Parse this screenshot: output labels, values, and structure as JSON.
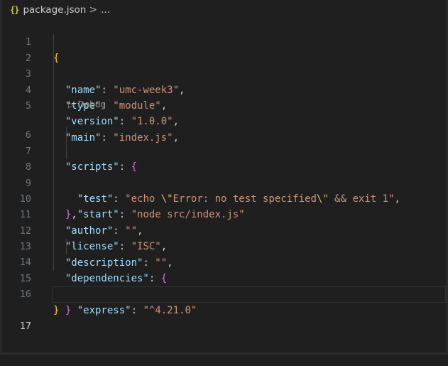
{
  "breadcrumb": {
    "icon": "{}",
    "file": "package.json",
    "separator": ">",
    "more": "..."
  },
  "codelens": {
    "label": "Debug",
    "icon": "play-outline-icon"
  },
  "lines": {
    "n1": "1",
    "n2": "2",
    "n3": "3",
    "n4": "4",
    "n5": "5",
    "n6": "6",
    "n7": "7",
    "n8": "8",
    "n9": "9",
    "n10": "10",
    "n11": "11",
    "n12": "12",
    "n13": "13",
    "n14": "14",
    "n15": "15",
    "n16": "16",
    "n17": "17"
  },
  "json": {
    "open_brace": "{",
    "close_brace": "}",
    "name_key": "\"name\"",
    "name_val": "\"umc-week3\"",
    "type_key": "\"type\"",
    "type_val": "\"module\"",
    "version_key": "\"version\"",
    "version_val": "\"1.0.0\"",
    "main_key": "\"main\"",
    "main_val": "\"index.js\"",
    "scripts_key": "\"scripts\"",
    "test_key": "\"test\"",
    "test_val_1": "\"echo ",
    "test_esc_1": "\\\"",
    "test_val_2": "Error: no test specified",
    "test_esc_2": "\\\"",
    "test_val_3": " && exit 1\"",
    "start_key": "\"start\"",
    "start_val": "\"node src/index.js\"",
    "author_key": "\"author\"",
    "author_val": "\"\"",
    "license_key": "\"license\"",
    "license_val": "\"ISC\"",
    "description_key": "\"description\"",
    "description_val": "\"\"",
    "dependencies_key": "\"dependencies\"",
    "express_key": "\"express\"",
    "express_val": "\"^4.21.0\""
  },
  "colors": {
    "background": "#1f1f1f",
    "json_key": "#9cdcfe",
    "json_string": "#ce9178",
    "bracket_level_1": "#ffd700",
    "bracket_level_2": "#da70d6",
    "escape": "#d7ba7d",
    "line_number": "#6e7681",
    "json_icon": "#cbcb41"
  }
}
